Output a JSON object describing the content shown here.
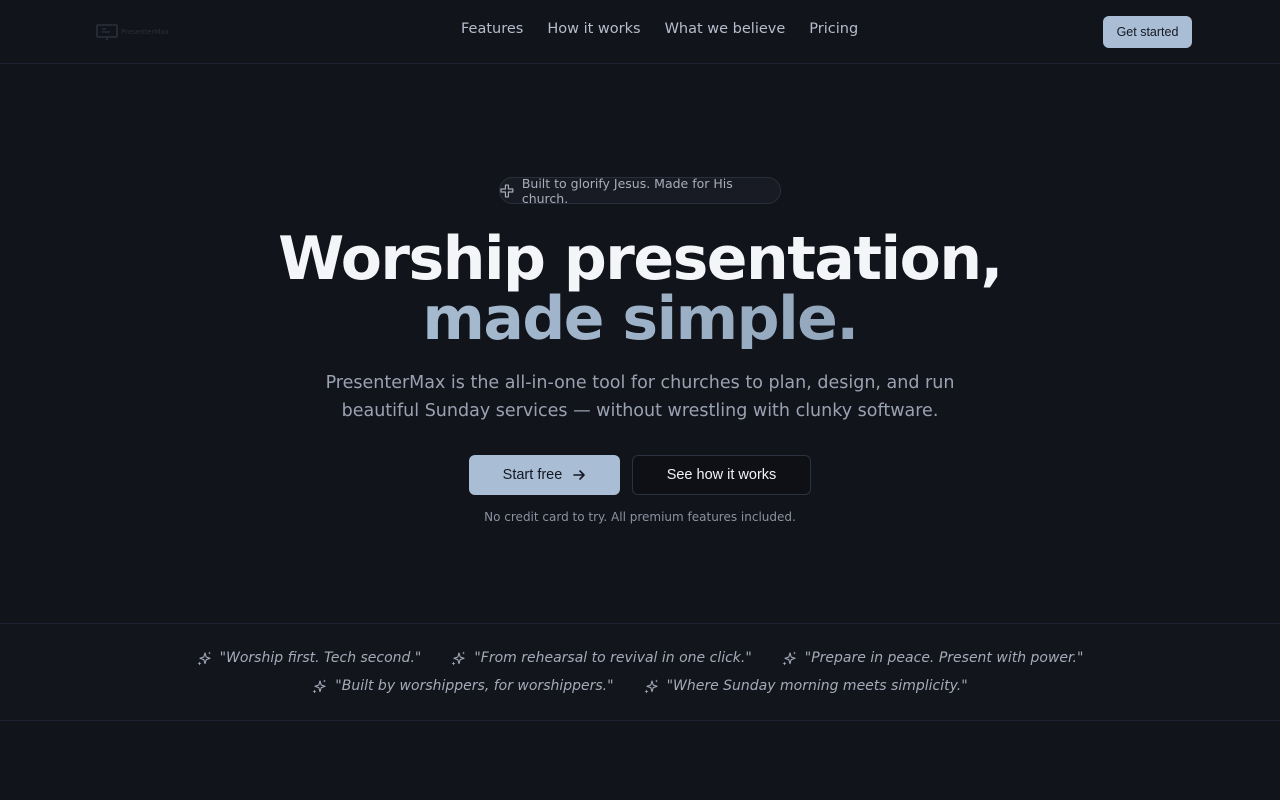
{
  "header": {
    "logo_text": "PresenterMax",
    "nav": [
      "Features",
      "How it works",
      "What we believe",
      "Pricing"
    ],
    "cta": "Get started"
  },
  "hero": {
    "badge": "Built to glorify Jesus. Made for His church.",
    "title_line1": "Worship presentation,",
    "title_line2": "made simple.",
    "lead": "PresenterMax is the all-in-one tool for churches to plan, design, and run beautiful Sunday services — without wrestling with clunky software.",
    "primary_button": "Start free",
    "secondary_button": "See how it works",
    "note": "No credit card to try. All premium features included."
  },
  "quotes": [
    "\"Worship first. Tech second.\"",
    "\"From rehearsal to revival in one click.\"",
    "\"Prepare in peace. Present with power.\"",
    "\"Built by worshippers, for worshippers.\"",
    "\"Where Sunday morning meets simplicity.\""
  ],
  "colors": {
    "accent": "#a9bdd4",
    "background": "#12141b",
    "text": "#f4f5f8"
  },
  "icons": {
    "logo": "presentation-screen-icon",
    "badge": "cross-icon",
    "arrow": "arrow-right-icon",
    "quote": "sparkles-icon"
  }
}
